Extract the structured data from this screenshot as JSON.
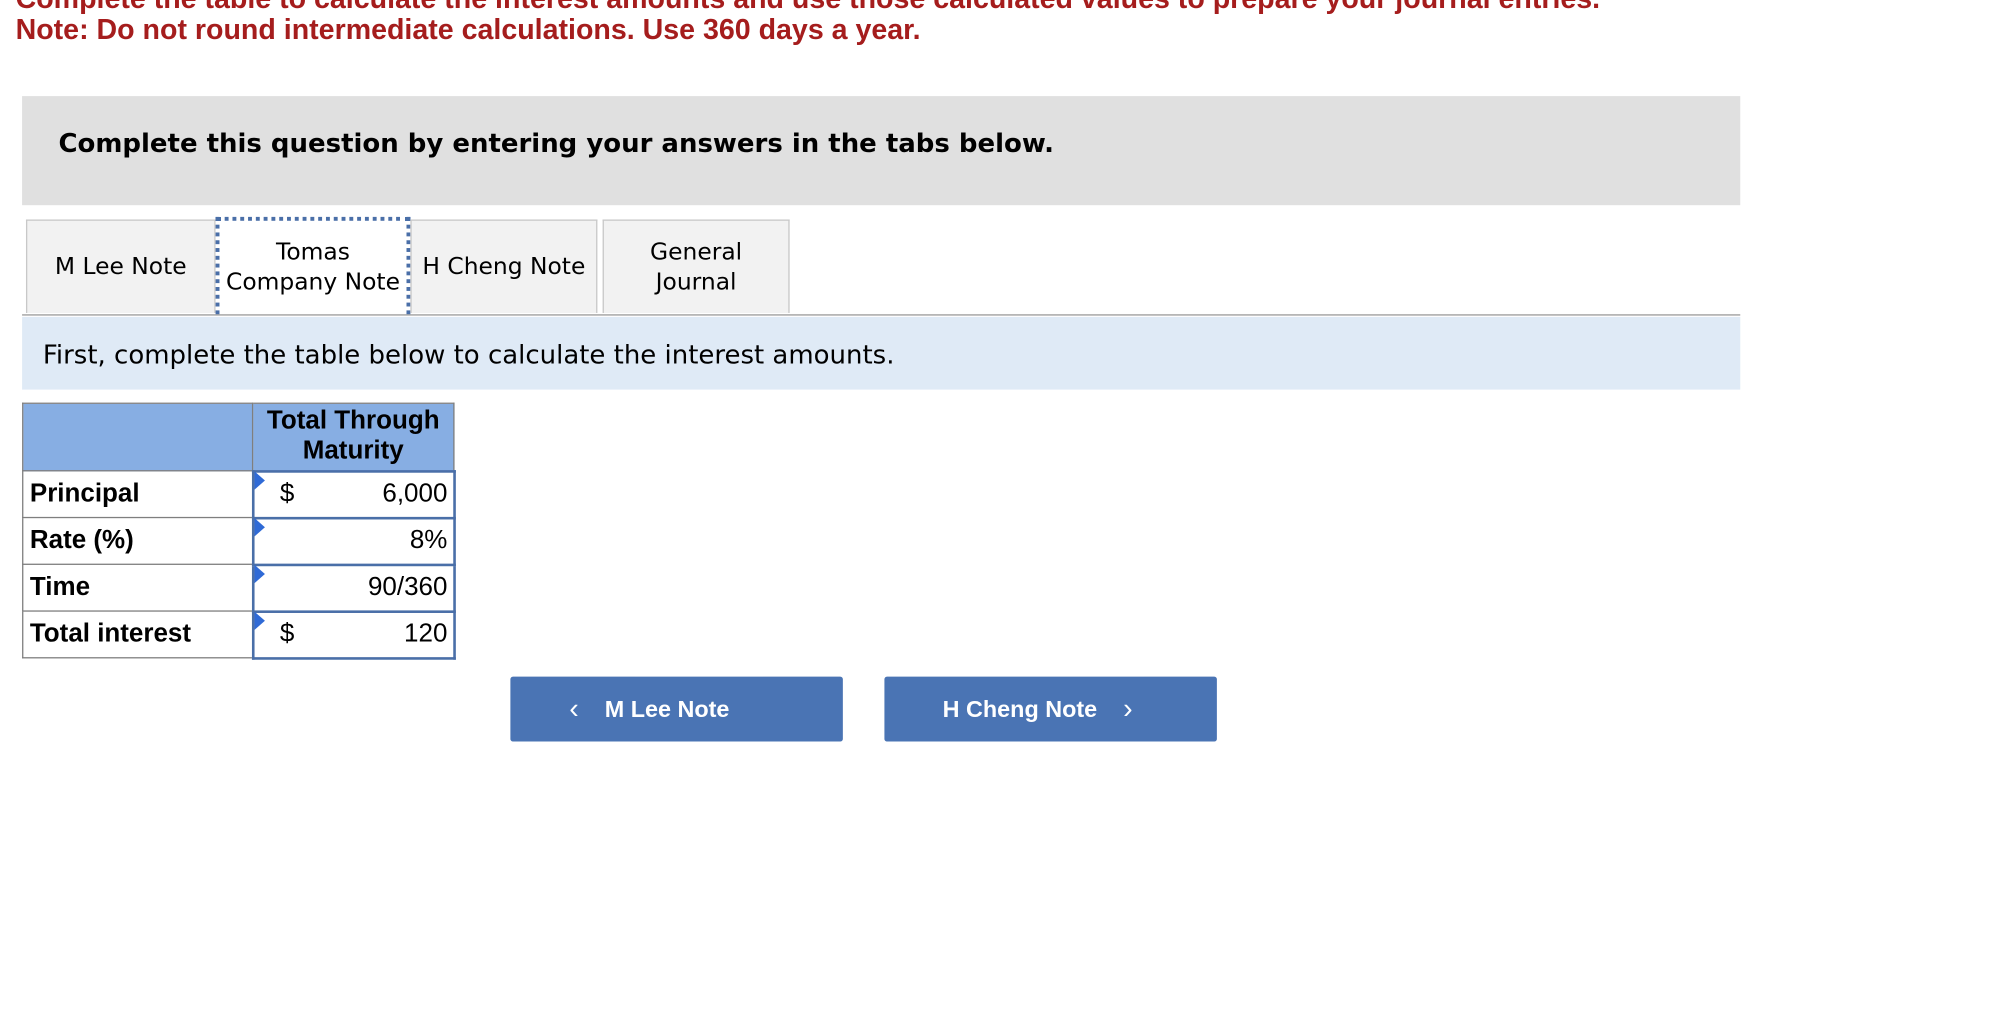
{
  "header": {
    "cut_line": "Complete the table to calculate the interest amounts and use those calculated values to prepare your journal entries.",
    "note": "Note: Do not round intermediate calculations. Use 360 days a year."
  },
  "instruction": "Complete this question by entering your answers in the tabs below.",
  "tabs": [
    {
      "label": "M Lee Note"
    },
    {
      "label": "Tomas Company Note"
    },
    {
      "label": "H Cheng Note"
    },
    {
      "label": "General Journal"
    }
  ],
  "active_tab": "Tomas Company Note",
  "info_text": "First, complete the table below to calculate the interest amounts.",
  "table": {
    "column_header": "Total Through Maturity",
    "rows": [
      {
        "label": "Principal",
        "currency": "$",
        "value": "6,000"
      },
      {
        "label": "Rate (%)",
        "currency": "",
        "value": "8%"
      },
      {
        "label": "Time",
        "currency": "",
        "value": "90/360"
      },
      {
        "label": "Total interest",
        "currency": "$",
        "value": "120"
      }
    ]
  },
  "nav": {
    "prev_label": "M Lee Note",
    "next_label": "H Cheng Note",
    "prev_icon": "chevron-left-icon",
    "next_icon": "chevron-right-icon"
  },
  "colors": {
    "note_red": "#a51d1d",
    "header_blue": "#87aee3",
    "button_blue": "#4a74b4",
    "info_band": "#dfeaf6"
  }
}
